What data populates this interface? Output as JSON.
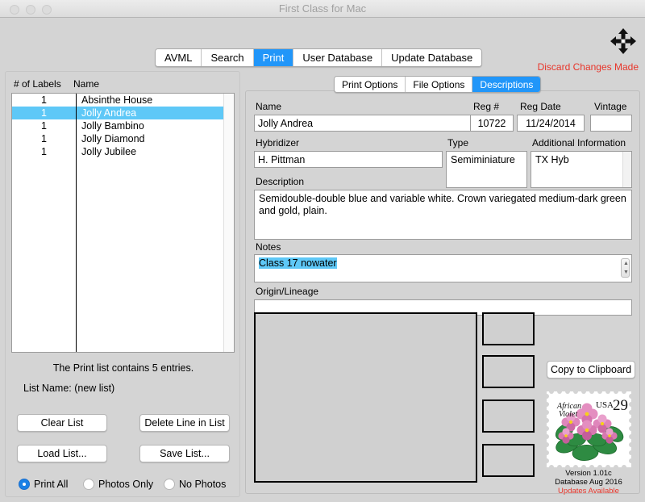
{
  "window": {
    "title": "First Class for Mac",
    "traffic_lights": [
      "close",
      "minimize",
      "maximize"
    ],
    "expand_icon": "four-arrow-move-icon"
  },
  "top_tabs": [
    {
      "label": "AVML",
      "active": false
    },
    {
      "label": "Search",
      "active": false
    },
    {
      "label": "Print",
      "active": true
    },
    {
      "label": "User Database",
      "active": false
    },
    {
      "label": "Update Database",
      "active": false
    }
  ],
  "discard_notice": "Discard Changes Made",
  "left_panel": {
    "col_labels": "# of Labels",
    "col_name": "Name",
    "rows": [
      {
        "count": "1",
        "name": "Absinthe House",
        "selected": false
      },
      {
        "count": "1",
        "name": "Jolly Andrea",
        "selected": true
      },
      {
        "count": "1",
        "name": "Jolly Bambino",
        "selected": false
      },
      {
        "count": "1",
        "name": "Jolly Diamond",
        "selected": false
      },
      {
        "count": "1",
        "name": "Jolly Jubilee",
        "selected": false
      }
    ],
    "entries_text": "The Print list contains 5 entries.",
    "list_name_text": "List Name: (new list)",
    "buttons": {
      "clear_list": "Clear List",
      "delete_line": "Delete Line in List",
      "load_list": "Load List...",
      "save_list": "Save List..."
    },
    "radios": [
      {
        "label": "Print All",
        "selected": true
      },
      {
        "label": "Photos Only",
        "selected": false
      },
      {
        "label": "No Photos",
        "selected": false
      }
    ]
  },
  "sub_tabs": [
    {
      "label": "Print Options",
      "active": false
    },
    {
      "label": "File Options",
      "active": false
    },
    {
      "label": "Descriptions",
      "active": true
    }
  ],
  "form": {
    "name_label": "Name",
    "name_value": "Jolly Andrea",
    "regnum_label": "Reg #",
    "regnum_value": "10722",
    "regdate_label": "Reg Date",
    "regdate_value": "11/24/2014",
    "vintage_label": "Vintage",
    "vintage_value": "",
    "hybridizer_label": "Hybridizer",
    "hybridizer_value": "H. Pittman",
    "type_label": "Type",
    "type_value": "Semiminiature",
    "addinfo_label": "Additional Information",
    "addinfo_value": "TX Hyb",
    "description_label": "Description",
    "description_value": "Semidouble-double blue and variable white. Crown variegated medium-dark green and gold, plain.",
    "notes_label": "Notes",
    "notes_value": "Class 17 nowater",
    "origin_label": "Origin/Lineage",
    "origin_value": ""
  },
  "copy_button": "Copy to Clipboard",
  "stamp": {
    "caption_line1": "African",
    "caption_line2": "Violet",
    "country": "USA",
    "denomination": "29"
  },
  "footer": {
    "version": "Version 1.01c",
    "database": "Database Aug 2016",
    "updates": "Updates Available"
  },
  "colors": {
    "accent_blue": "#2196f9",
    "selection_blue": "#5ec8f7",
    "alert_red": "#e8352a",
    "window_bg": "#d4d4d4"
  }
}
